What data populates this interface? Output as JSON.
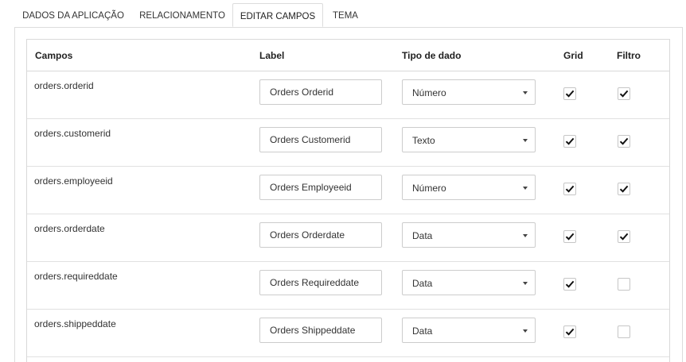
{
  "tabs": [
    {
      "label": "DADOS DA APLICAÇÃO",
      "active": false
    },
    {
      "label": "RELACIONAMENTO",
      "active": false
    },
    {
      "label": "EDITAR CAMPOS",
      "active": true
    },
    {
      "label": "TEMA",
      "active": false
    }
  ],
  "table": {
    "headers": {
      "campos": "Campos",
      "label": "Label",
      "tipo": "Tipo de dado",
      "grid": "Grid",
      "filtro": "Filtro"
    },
    "rows": [
      {
        "field": "orders.orderid",
        "label": "Orders Orderid",
        "type": "Número",
        "grid": true,
        "filter": true
      },
      {
        "field": "orders.customerid",
        "label": "Orders Customerid",
        "type": "Texto",
        "grid": true,
        "filter": true
      },
      {
        "field": "orders.employeeid",
        "label": "Orders Employeeid",
        "type": "Número",
        "grid": true,
        "filter": true
      },
      {
        "field": "orders.orderdate",
        "label": "Orders Orderdate",
        "type": "Data",
        "grid": true,
        "filter": true
      },
      {
        "field": "orders.requireddate",
        "label": "Orders Requireddate",
        "type": "Data",
        "grid": true,
        "filter": false
      },
      {
        "field": "orders.shippeddate",
        "label": "Orders Shippeddate",
        "type": "Data",
        "grid": true,
        "filter": false
      }
    ]
  },
  "icons": {
    "select": "chevron-down-icon",
    "check": "check-icon"
  }
}
